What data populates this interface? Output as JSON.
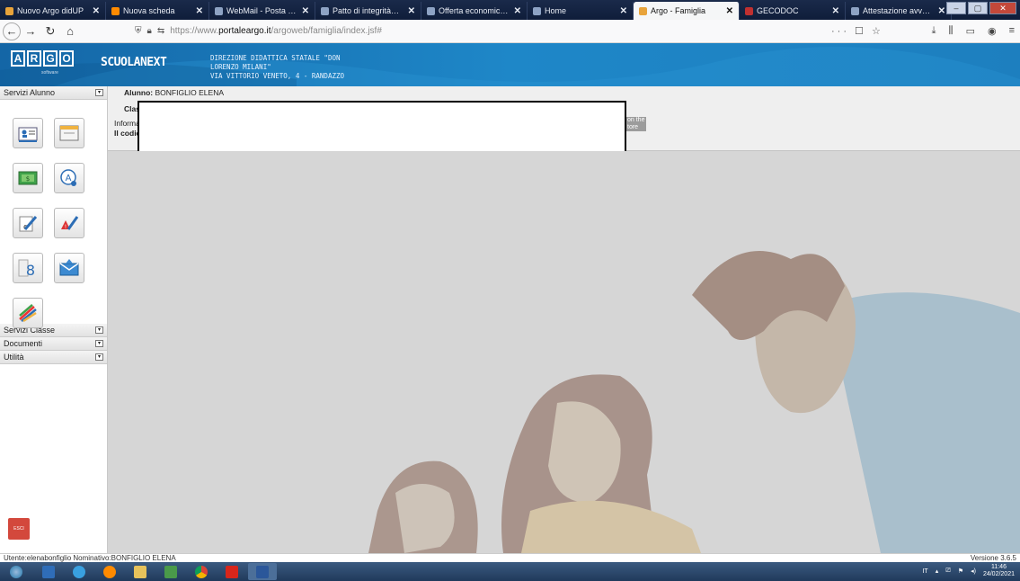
{
  "browser": {
    "tabs": [
      {
        "title": "Nuovo Argo didUP",
        "icon": "argo-icon",
        "color": "#e8a33a"
      },
      {
        "title": "Nuova scheda",
        "icon": "firefox-icon",
        "color": "#ff8a00"
      },
      {
        "title": "WebMail - Posta in arrivo - c",
        "icon": "mail-icon",
        "color": ""
      },
      {
        "title": "Patto di integrità_DON MILA",
        "icon": "document-icon",
        "color": ""
      },
      {
        "title": "Offerta economica_DON MIL",
        "icon": "document-icon",
        "color": ""
      },
      {
        "title": "Home",
        "icon": "home-icon",
        "color": ""
      },
      {
        "title": "Argo - Famiglia",
        "icon": "argo-icon",
        "color": "#e8a33a"
      },
      {
        "title": "GECODOC",
        "icon": "gecodoc-icon",
        "color": "#c03030"
      },
      {
        "title": "Attestazione avvenuto sopral",
        "icon": "document-icon",
        "color": ""
      }
    ],
    "active_tab": 6,
    "close_glyph": "✕",
    "new_tab_glyph": "+",
    "url_prefix": "https://www.",
    "url_domain": "portaleargo.it",
    "url_path": "/argoweb/famiglia/index.jsf#",
    "url_right_icons": "··· ☐ ☆",
    "nav_right_icons": [
      "download-icon",
      "library-icon",
      "sidebar-icon",
      "account-icon",
      "menu-icon"
    ]
  },
  "argo": {
    "logo_letters": [
      "A",
      "R",
      "G",
      "O"
    ],
    "logo_subtitle": "software",
    "product": "SCUOLANEXT",
    "school_line1": "DIREZIONE DIDATTICA STATALE \"DON",
    "school_line2": "LORENZO MILANI\"",
    "school_line3": "VIA VITTORIO VENETO, 4 - RANDAZZO"
  },
  "sidebar": {
    "servizi_alunno": "Servizi Alunno",
    "servizi_classe": "Servizi Classe",
    "documenti": "Documenti",
    "utilita": "Utilità",
    "toggle_glyph": "▾",
    "esci": "ESCI"
  },
  "main": {
    "student_label": "Alunno:",
    "student_name": "BONFIGLIO ELENA",
    "class_prefix": "Clas",
    "info_prefix": "Informa",
    "code_prefix": "Il codice",
    "side_text_1": "on the",
    "side_text_2": "tore"
  },
  "status": {
    "user": "Utente:elenabonfiglio Nominativo:BONFIGLIO ELENA",
    "version": "Versione 3.6.5"
  },
  "taskbar": {
    "lang": "IT",
    "time": "11:46",
    "date": "24/02/2021"
  }
}
